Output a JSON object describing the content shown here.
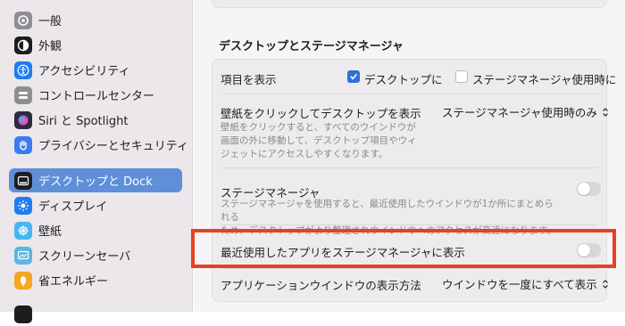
{
  "sidebar": {
    "items": [
      {
        "label": "一般",
        "icon": "gear-icon"
      },
      {
        "label": "外観",
        "icon": "appearance-icon"
      },
      {
        "label": "アクセシビリティ",
        "icon": "accessibility-icon"
      },
      {
        "label": "コントロールセンター",
        "icon": "control-center-icon"
      },
      {
        "label": "Siri と Spotlight",
        "icon": "siri-icon"
      },
      {
        "label": "プライバシーとセキュリティ",
        "icon": "hand-icon"
      },
      {
        "label": "デスクトップと Dock",
        "icon": "dock-icon",
        "selected": true
      },
      {
        "label": "ディスプレイ",
        "icon": "display-icon"
      },
      {
        "label": "壁紙",
        "icon": "wallpaper-icon"
      },
      {
        "label": "スクリーンセーバ",
        "icon": "screensaver-icon"
      },
      {
        "label": "省エネルギー",
        "icon": "energy-icon"
      }
    ]
  },
  "main": {
    "section_title": "デスクトップとステージマネージャ",
    "show_items": {
      "label": "項目を表示",
      "option_desktop": "デスクトップに",
      "option_desktop_checked": true,
      "option_stage": "ステージマネージャ使用時に",
      "option_stage_checked": false
    },
    "click_wallpaper": {
      "label": "壁紙をクリックしてデスクトップを表示",
      "description_1": "壁紙をクリックすると、すべてのウインドウが",
      "description_2": "画面の外に移動して、デスクトップ項目やウィ",
      "description_3": "ジェットにアクセスしやすくなります。",
      "value": "ステージマネージャ使用時のみ"
    },
    "stage_manager": {
      "label": "ステージマネージャ",
      "description_1": "ステージマネージャを使用すると、最近使用したウインドウが1か所にまとめられる",
      "description_2": "ため、デスクトップがより整理されウインドウへのアクセスが高速になります。",
      "enabled": false
    },
    "recent_apps": {
      "label": "最近使用したアプリをステージマネージャに表示",
      "enabled": false
    },
    "app_windows": {
      "label": "アプリケーションウインドウの表示方法",
      "value": "ウインドウを一度にすべて表示"
    }
  },
  "colors": {
    "accent": "#2f6fd6",
    "selection": "#5f8fd8",
    "highlight_box": "#e5421f"
  }
}
